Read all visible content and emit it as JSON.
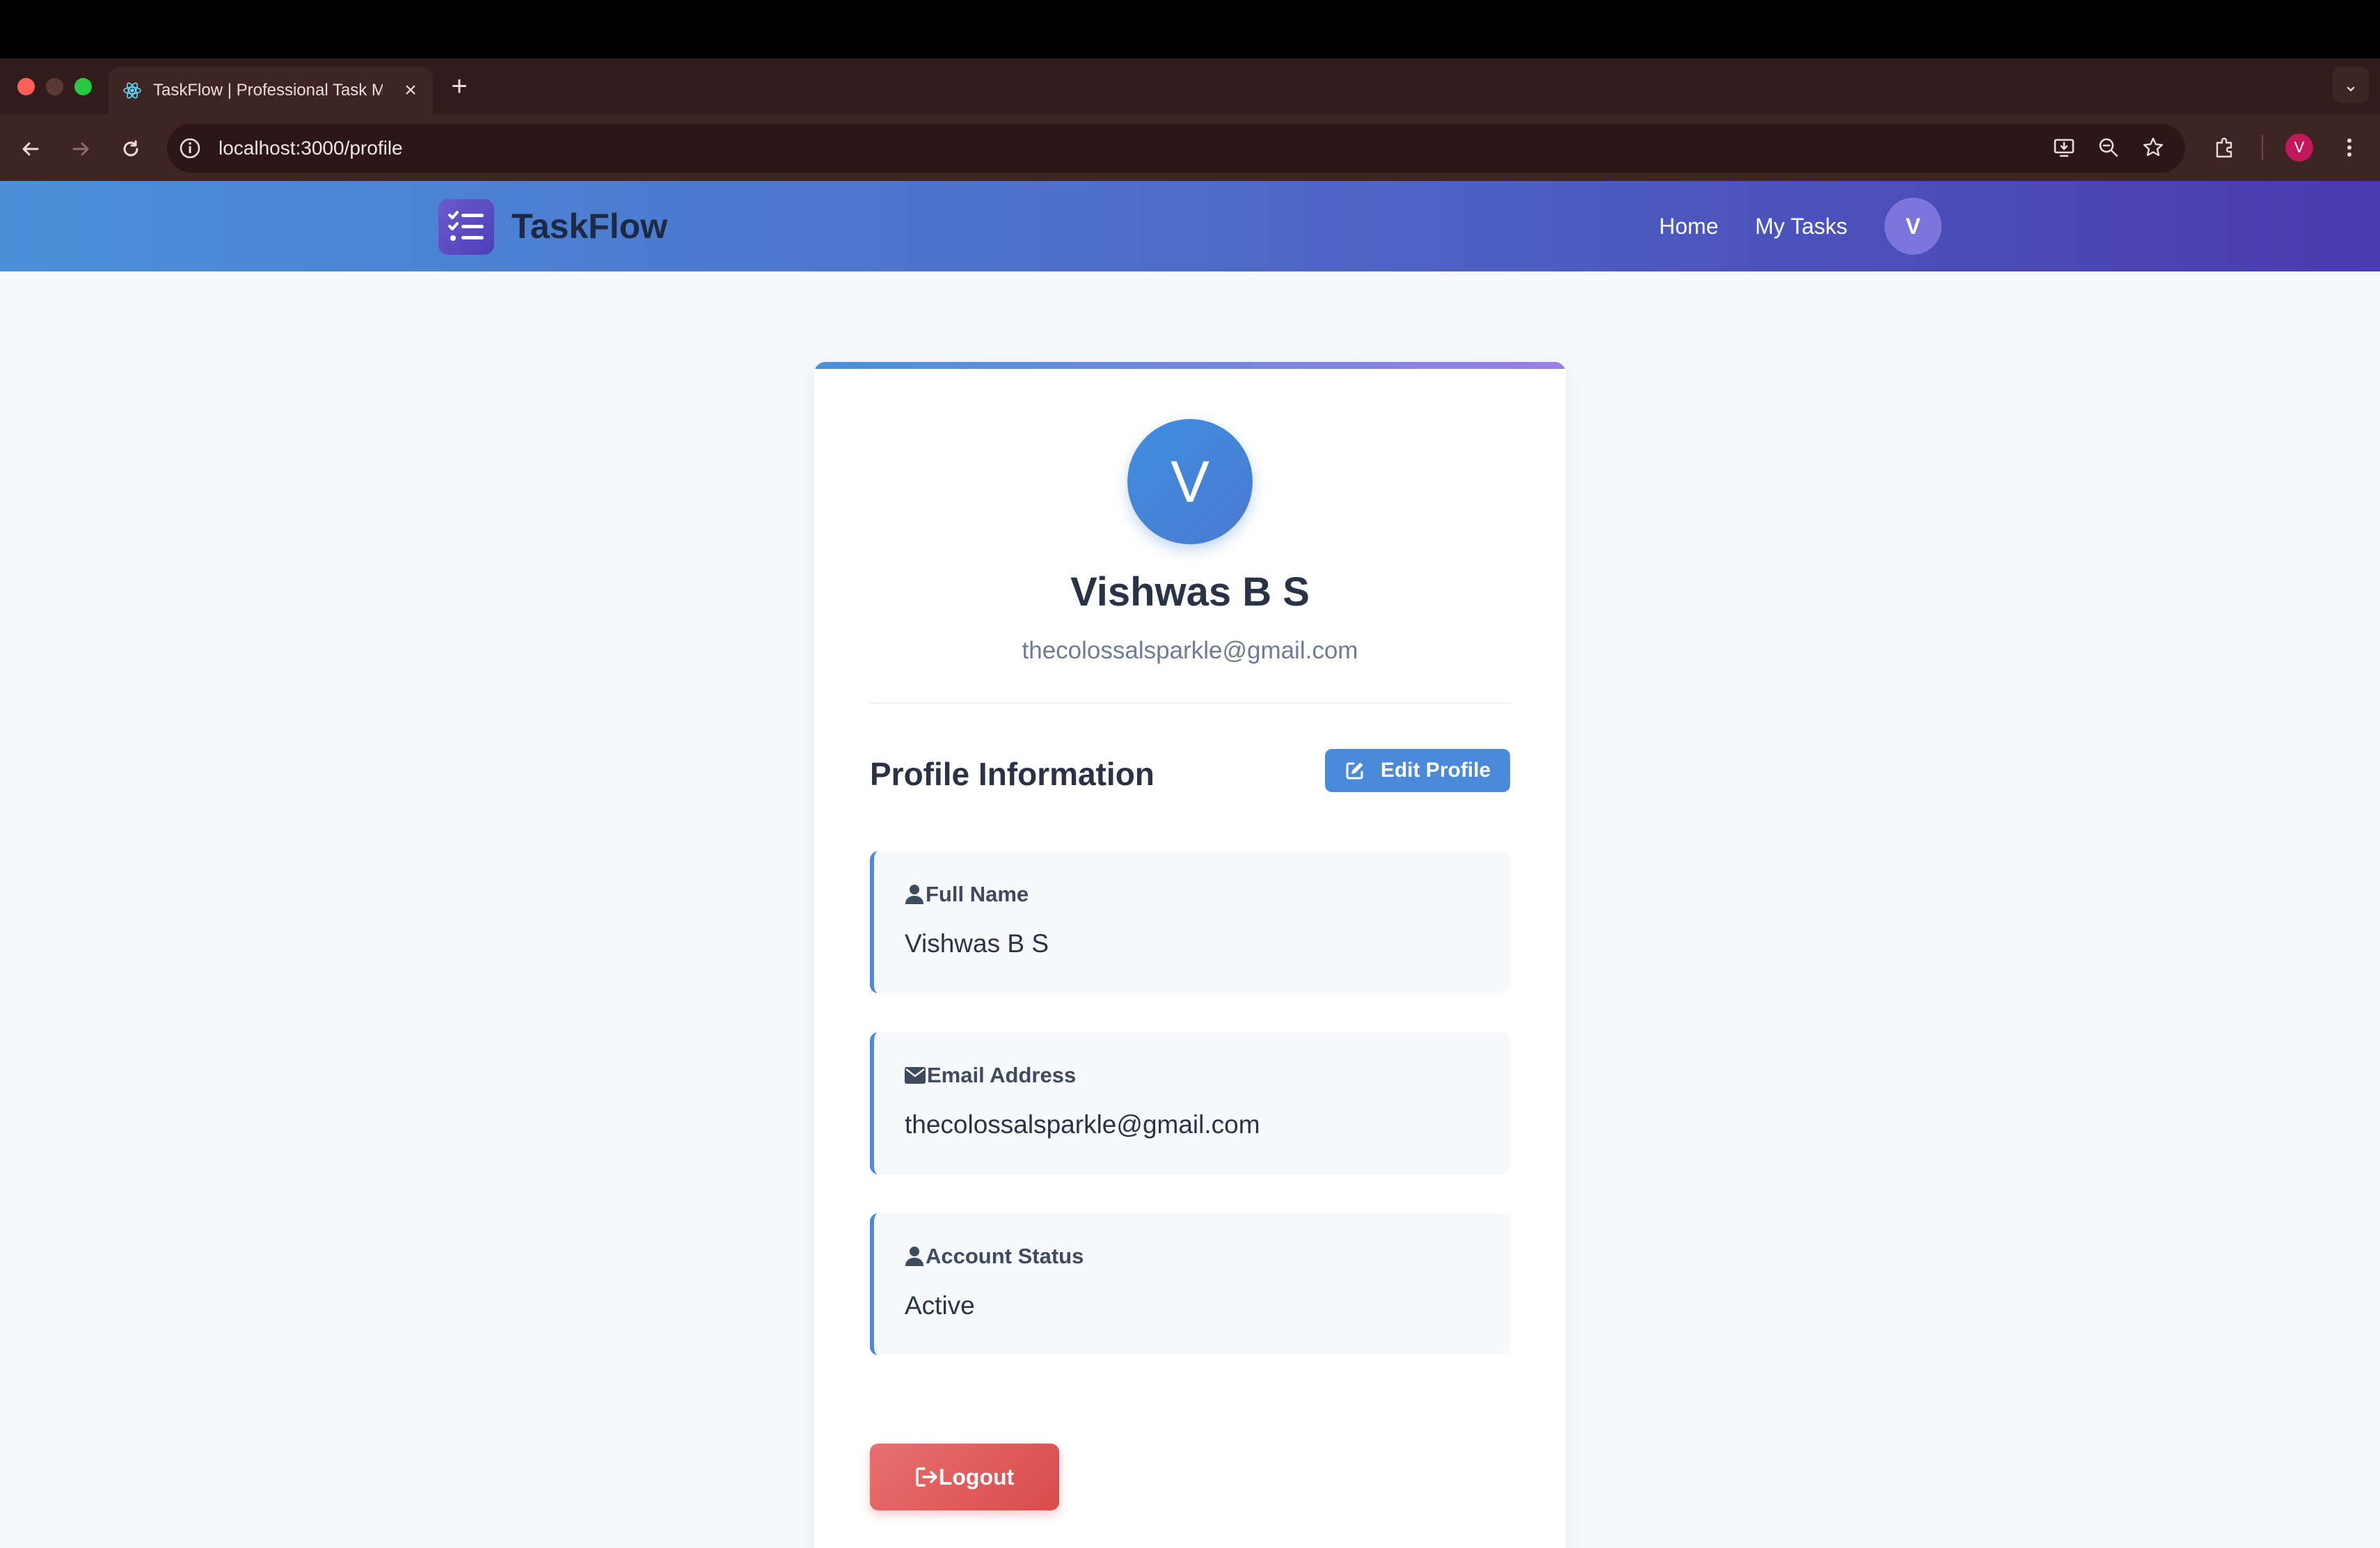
{
  "browser": {
    "tab_title": "TaskFlow | Professional Task Manager",
    "url": "localhost:3000/profile",
    "profile_initial": "V"
  },
  "app": {
    "logo_text": "TaskFlow",
    "nav": {
      "home": "Home",
      "my_tasks": "My Tasks",
      "avatar_initial": "V"
    }
  },
  "profile": {
    "avatar_initial": "V",
    "name": "Vishwas B S",
    "email": "thecolossalsparkle@gmail.com",
    "section_title": "Profile Information",
    "edit_label": "Edit Profile",
    "fields": [
      {
        "label": "Full Name",
        "value": "Vishwas B S",
        "icon": "user-icon"
      },
      {
        "label": "Email Address",
        "value": "thecolossalsparkle@gmail.com",
        "icon": "envelope-icon"
      },
      {
        "label": "Account Status",
        "value": "Active",
        "icon": "user-icon"
      }
    ],
    "logout_label": "Logout"
  },
  "colors": {
    "header_gradient_start": "#4a90d9",
    "header_gradient_end": "#4a3aaf",
    "accent": "#4a8ad8",
    "danger": "#d94b4b"
  }
}
